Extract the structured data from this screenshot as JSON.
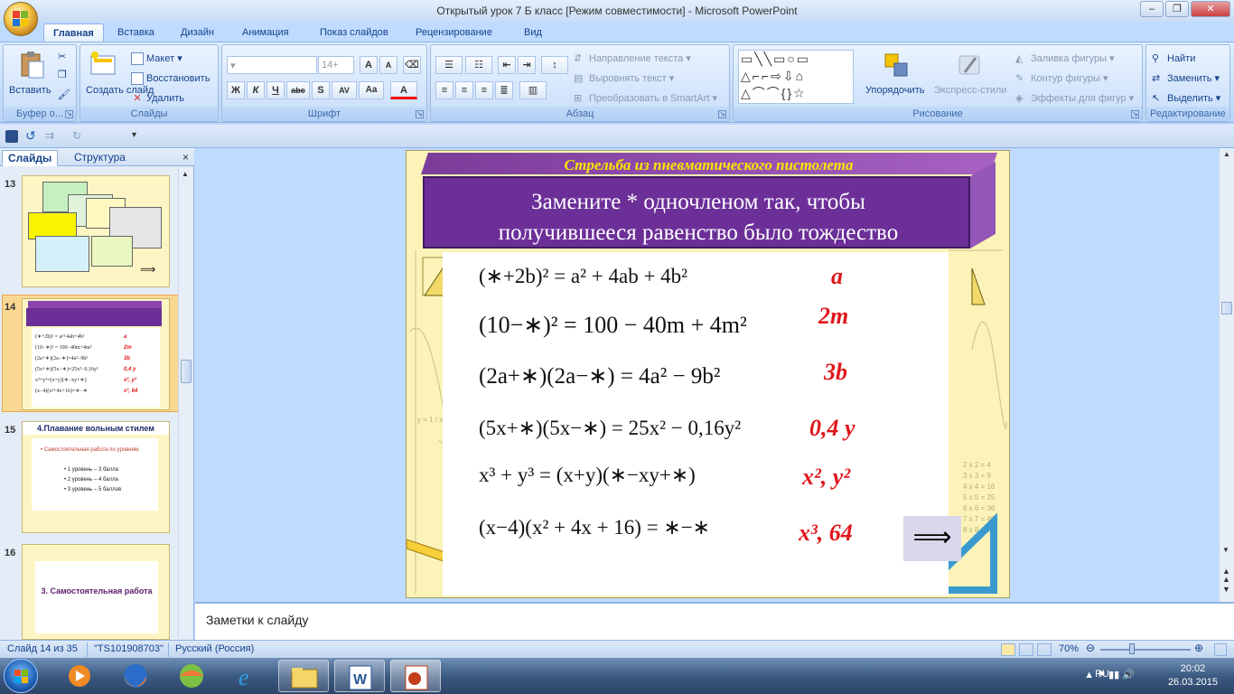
{
  "window": {
    "title": "Открытый урок 7 Б класс [Режим совместимости] - Microsoft PowerPoint"
  },
  "tabs": [
    "Главная",
    "Вставка",
    "Дизайн",
    "Анимация",
    "Показ слайдов",
    "Рецензирование",
    "Вид"
  ],
  "ribbon": {
    "clipboard": {
      "label": "Буфер о...",
      "paste": "Вставить"
    },
    "slides": {
      "label": "Слайды",
      "new_slide": "Создать слайд",
      "layout": "Макет",
      "reset": "Восстановить",
      "delete": "Удалить"
    },
    "font": {
      "label": "Шрифт",
      "size_placeholder": "14+",
      "bold": "Ж",
      "italic": "К",
      "underline": "Ч",
      "strike": "abc",
      "shadow": "S",
      "spacing": "AV",
      "case": "Aa",
      "color": "A",
      "grow": "A",
      "shrink": "A"
    },
    "paragraph": {
      "label": "Абзац",
      "text_direction": "Направление текста",
      "align_text": "Выровнять текст",
      "smartart": "Преобразовать в SmartArt"
    },
    "drawing": {
      "label": "Рисование",
      "arrange": "Упорядочить",
      "quick_styles": "Экспресс-стили",
      "fill": "Заливка фигуры",
      "outline": "Контур фигуры",
      "effects": "Эффекты для фигур"
    },
    "editing": {
      "label": "Редактирование",
      "find": "Найти",
      "replace": "Заменить",
      "select": "Выделить"
    }
  },
  "left_pane": {
    "tab_slides": "Слайды",
    "tab_outline": "Структура",
    "close": "×",
    "slides": [
      {
        "num": "13"
      },
      {
        "num": "14"
      },
      {
        "num": "15",
        "title": "4.Плавание вольным стилем",
        "bullet": "Самостоятельная работа по уровням.",
        "levels": [
          "1 уровень – 3 балла",
          "2 уровень – 4 балла",
          "3 уровень – 5 баллов"
        ]
      },
      {
        "num": "16",
        "title": "3. Самостоятельная работа"
      }
    ]
  },
  "slide": {
    "header": "Стрельба из пневматического пистолета",
    "banner_line1": "Замените * одночленом так, чтобы",
    "banner_line2": "получившееся равенство было тождество",
    "equations": [
      "(∗+2b)² = a² + 4ab + 4b²",
      "(10−∗)² = 100 − 40m + 4m²",
      "(2a+∗)(2a−∗) = 4a² − 9b²",
      "(5x+∗)(5x−∗) = 25x² − 0,16y²",
      "x³ + y³ = (x+y)(∗−xy+∗)",
      "(x−4)(x² + 4x + 16) = ∗−∗"
    ],
    "answers": [
      "a",
      "2m",
      "3b",
      "0,4 y",
      "x², y²",
      "x³, 64"
    ],
    "next_arrow": "⟹"
  },
  "notes": {
    "placeholder": "Заметки к слайду"
  },
  "status": {
    "slide_info": "Слайд 14 из 35",
    "theme": "\"TS101908703\"",
    "language": "Русский (Россия)",
    "zoom": "70%"
  },
  "taskbar": {
    "lang": "RU",
    "time": "20:02",
    "date": "26.03.2015"
  }
}
